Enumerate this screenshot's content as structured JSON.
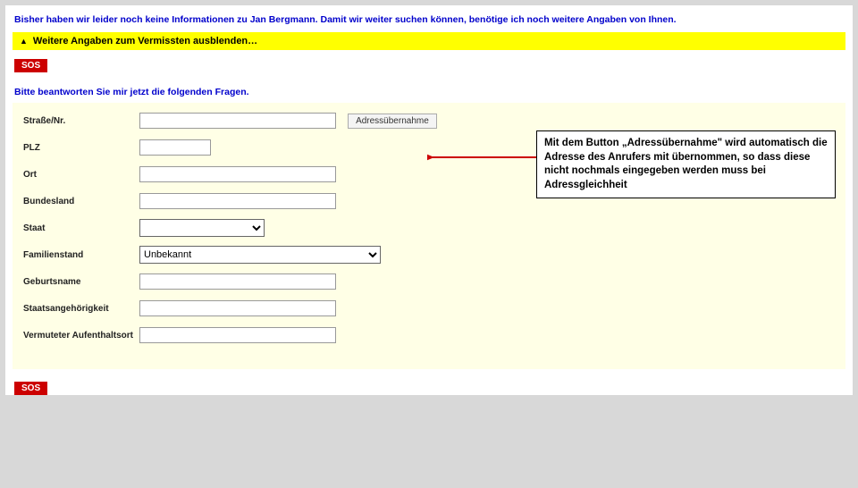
{
  "info_text": "Bisher haben wir leider noch keine Informationen zu Jan Bergmann. Damit wir weiter suchen können, benötige ich noch weitere Angaben von Ihnen.",
  "yellow_bar": {
    "arrow": "▲",
    "text": "Weitere Angaben zum Vermissten ausblenden…"
  },
  "sos_label": "SOS",
  "prompt": "Bitte beantworten Sie mir jetzt die folgenden Fragen.",
  "form": {
    "strasse": {
      "label": "Straße/Nr.",
      "value": ""
    },
    "plz": {
      "label": "PLZ",
      "value": ""
    },
    "ort": {
      "label": "Ort",
      "value": ""
    },
    "bundesland": {
      "label": "Bundesland",
      "value": ""
    },
    "staat": {
      "label": "Staat",
      "value": ""
    },
    "familienstand": {
      "label": "Familienstand",
      "value": "Unbekannt"
    },
    "geburtsname": {
      "label": "Geburtsname",
      "value": ""
    },
    "staatsang": {
      "label": "Staatsangehörigkeit",
      "value": ""
    },
    "aufenthalt": {
      "label": "Vermuteter Aufenthaltsort",
      "value": ""
    }
  },
  "adr_button": "Adressübernahme",
  "callout": "Mit dem Button „Adressübernahme\" wird automatisch die Adresse des Anrufers mit übernommen, so dass diese nicht nochmals eingegeben werden muss bei Adressgleichheit"
}
